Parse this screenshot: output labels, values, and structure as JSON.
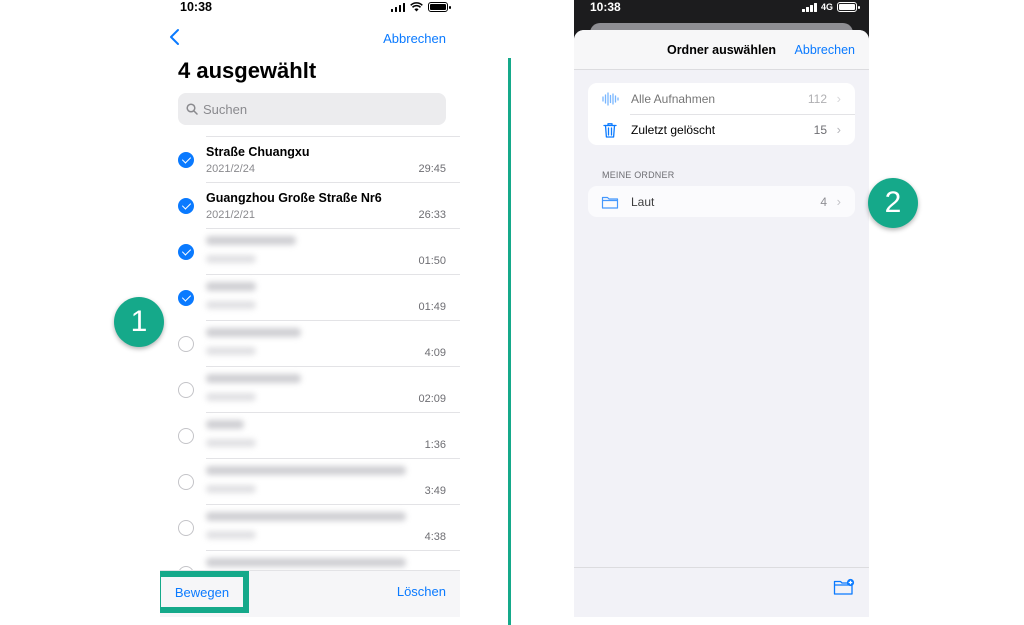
{
  "left": {
    "status_time": "10:38",
    "cancel_label": "Abbrechen",
    "title": "4 ausgewählt",
    "search_placeholder": "Suchen",
    "rows": [
      {
        "name": "Straße Chuangxu",
        "date": "2021/2/24",
        "duration": "29:45",
        "checked": true
      },
      {
        "name": "Guangzhou Große Straße Nr6",
        "date": "2021/2/21",
        "duration": "26:33",
        "checked": true
      },
      {
        "duration": "01:50",
        "checked": true
      },
      {
        "duration": "01:49",
        "checked": true
      },
      {
        "duration": "4:09",
        "checked": false
      },
      {
        "duration": "02:09",
        "checked": false
      },
      {
        "duration": "1:36",
        "checked": false
      },
      {
        "duration": "3:49",
        "checked": false
      },
      {
        "duration": "4:38",
        "checked": false
      }
    ],
    "move_label": "Bewegen",
    "delete_label": "Löschen"
  },
  "badges": {
    "one": "1",
    "two": "2"
  },
  "right": {
    "status_time": "10:38",
    "network": "4G",
    "sheet_title": "Ordner auswählen",
    "cancel_label": "Abbrechen",
    "all_recordings": {
      "label": "Alle Aufnahmen",
      "count": "112"
    },
    "recently_deleted": {
      "label": "Zuletzt gelöscht",
      "count": "15"
    },
    "section_header": "MEINE ORDNER",
    "folder": {
      "label": "Laut",
      "count": "4"
    }
  },
  "colors": {
    "accent": "#0a7aff",
    "highlight": "#15a98a"
  }
}
